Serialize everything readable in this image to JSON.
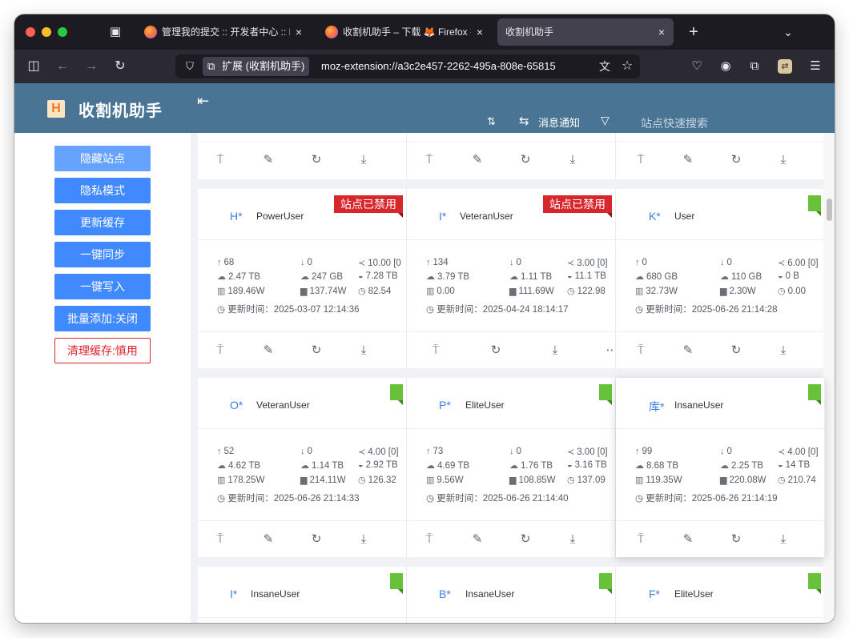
{
  "browser": {
    "tabs": [
      {
        "title": "管理我的提交 :: 开发者中心 :: Firefox",
        "active": false
      },
      {
        "title": "收割机助手 – 下载 🦊 Firefox 扩展",
        "active": false
      },
      {
        "title": "收割机助手",
        "active": true
      }
    ],
    "tab_close": "×",
    "new_tab": "+",
    "list_tabs": "⌄",
    "identity_label": "扩展 (收割机助手)",
    "url": "moz-extension://a3c2e457-2262-495a-808e-65815"
  },
  "app": {
    "logo_letter": "H",
    "title": "收割机助手",
    "notify_label": "消息通知",
    "search_placeholder": "站点快速搜索"
  },
  "sidebar": {
    "buttons": [
      "隐藏站点",
      "隐私模式",
      "更新缓存",
      "一键同步",
      "一键写入",
      "批量添加:关闭",
      "清理缓存:慎用"
    ]
  },
  "sites": [
    {
      "abbr": "H*",
      "level": "PowerUser",
      "banner": "站点已禁用",
      "up": "68",
      "down": "0",
      "ratio": "10.00 [0",
      "upload": "2.47 TB",
      "download": "247 GB",
      "seed": "7.28 TB",
      "bonus": "189.46W",
      "bonus2": "137.74W",
      "time": "82.54",
      "updated": "更新时间：2025-03-07 12:14:36"
    },
    {
      "abbr": "I*",
      "level": "VeteranUser",
      "banner": "站点已禁用",
      "up": "134",
      "down": "0",
      "ratio": "3.00 [0]",
      "upload": "3.79 TB",
      "download": "1.11 TB",
      "seed": "11.1 TB",
      "bonus": "0.00",
      "bonus2": "111.69W",
      "time": "122.98",
      "updated": "更新时间：2025-04-24 18:14:17"
    },
    {
      "abbr": "K*",
      "level": "User",
      "banner": "",
      "up": "0",
      "down": "0",
      "ratio": "6.00 [0]",
      "upload": "680 GB",
      "download": "110 GB",
      "seed": "0 B",
      "bonus": "32.73W",
      "bonus2": "2.30W",
      "time": "0.00",
      "updated": "更新时间：2025-06-26 21:14:28"
    },
    {
      "abbr": "O*",
      "level": "VeteranUser",
      "banner": "",
      "up": "52",
      "down": "0",
      "ratio": "4.00 [0]",
      "upload": "4.62 TB",
      "download": "1.14 TB",
      "seed": "2.92 TB",
      "bonus": "178.25W",
      "bonus2": "214.11W",
      "time": "126.32",
      "updated": "更新时间：2025-06-26 21:14:33"
    },
    {
      "abbr": "P*",
      "level": "EliteUser",
      "banner": "",
      "up": "73",
      "down": "0",
      "ratio": "3.00 [0]",
      "upload": "4.69 TB",
      "download": "1.76 TB",
      "seed": "3.16 TB",
      "bonus": "9.56W",
      "bonus2": "108.85W",
      "time": "137.09",
      "updated": "更新时间：2025-06-26 21:14:40"
    },
    {
      "abbr": "库*",
      "level": "InsaneUser",
      "banner": "",
      "up": "99",
      "down": "0",
      "ratio": "4.00 [0]",
      "upload": "8.68 TB",
      "download": "2.25 TB",
      "seed": "14 TB",
      "bonus": "119.35W",
      "bonus2": "220.08W",
      "time": "210.74",
      "updated": "更新时间：2025-06-26 21:14:19"
    },
    {
      "abbr": "I*",
      "level": "InsaneUser",
      "banner": ""
    },
    {
      "abbr": "B*",
      "level": "InsaneUser",
      "banner": ""
    },
    {
      "abbr": "F*",
      "level": "EliteUser",
      "banner": ""
    }
  ],
  "colors": {
    "header": "#4a7494",
    "primary_button": "#4089ff",
    "danger": "#e0262d",
    "enabled_flag": "#67c23a",
    "link_blue": "#3d7fe6"
  },
  "icons": {
    "stats": [
      "arrow-up-icon",
      "arrow-down-icon",
      "share-ratio-icon",
      "upload-cloud-icon",
      "download-cloud-icon",
      "seed-icon",
      "bonus-chart-icon",
      "clock-icon"
    ],
    "actions": [
      "paint-roller-icon",
      "edit-icon",
      "refresh-icon",
      "download-icon"
    ]
  }
}
